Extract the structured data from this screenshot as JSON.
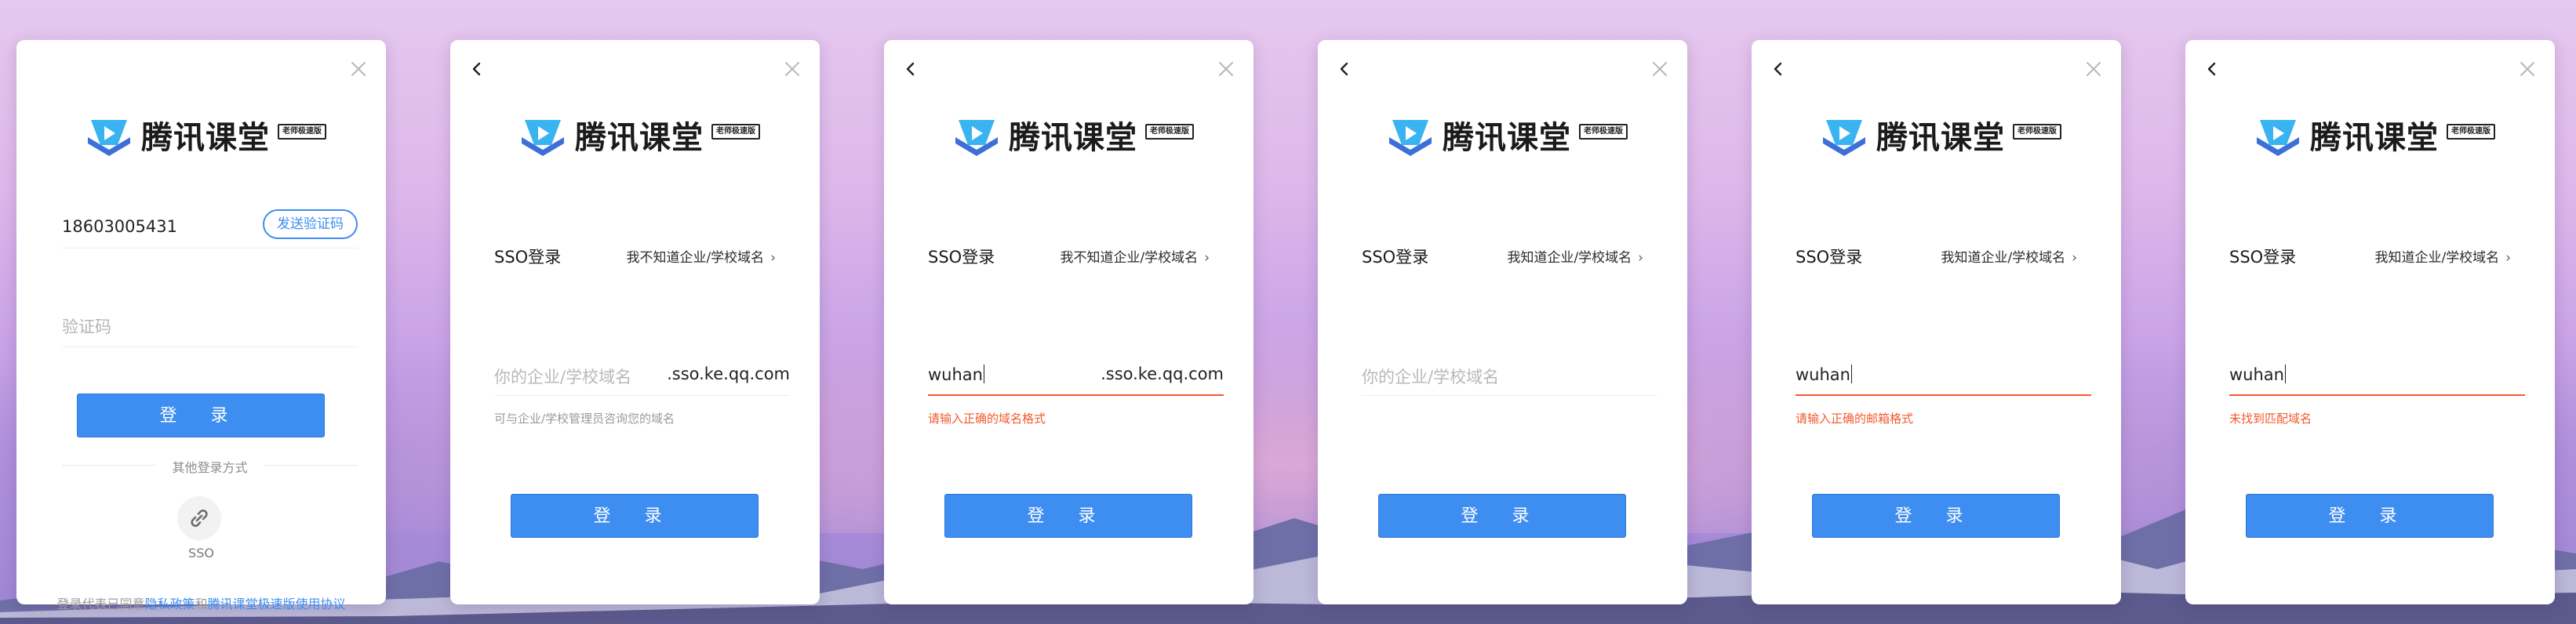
{
  "brand": {
    "name": "腾讯课堂",
    "badge": "老师极速版"
  },
  "colors": {
    "primary": "#3d8ef0",
    "error": "#f2592e",
    "panel": "#ffffff"
  },
  "panel1": {
    "phone_value": "18603005431",
    "send_code_label": "发送验证码",
    "code_placeholder": "验证码",
    "login_label": "登 录",
    "other_methods": "其他登录方式",
    "sso_label": "SSO",
    "agreement_prefix": "登录代表已同意",
    "privacy_link": "隐私政策",
    "agreement_and": "和",
    "terms_link": "腾讯课堂极速版使用协议"
  },
  "panel2": {
    "title": "SSO登录",
    "switch_label": "我不知道企业/学校域名",
    "placeholder": "你的企业/学校域名",
    "value": "",
    "suffix": ".sso.ke.qq.com",
    "hint": "可与企业/学校管理员咨询您的域名",
    "login_label": "登 录"
  },
  "panel3": {
    "title": "SSO登录",
    "switch_label": "我不知道企业/学校域名",
    "placeholder": "",
    "value": "wuhan",
    "suffix": ".sso.ke.qq.com",
    "hint": "请输入正确的域名格式",
    "login_label": "登 录"
  },
  "panel4": {
    "title": "SSO登录",
    "switch_label": "我知道企业/学校域名",
    "placeholder": "你的企业/学校域名",
    "value": "",
    "suffix": "",
    "hint": "",
    "login_label": "登 录"
  },
  "panel5": {
    "title": "SSO登录",
    "switch_label": "我知道企业/学校域名",
    "placeholder": "",
    "value": "wuhan",
    "suffix": "",
    "hint": "请输入正确的邮箱格式",
    "login_label": "登 录"
  },
  "panel6": {
    "title": "SSO登录",
    "switch_label": "我知道企业/学校域名",
    "placeholder": "",
    "value": "wuhan",
    "suffix": "",
    "hint": "未找到匹配域名",
    "login_label": "登 录"
  },
  "icons": {
    "close": "close-icon",
    "back": "chevron-left-icon",
    "logo": "play-logo-icon",
    "link": "link-icon",
    "chevron": "chevron-right-icon"
  }
}
